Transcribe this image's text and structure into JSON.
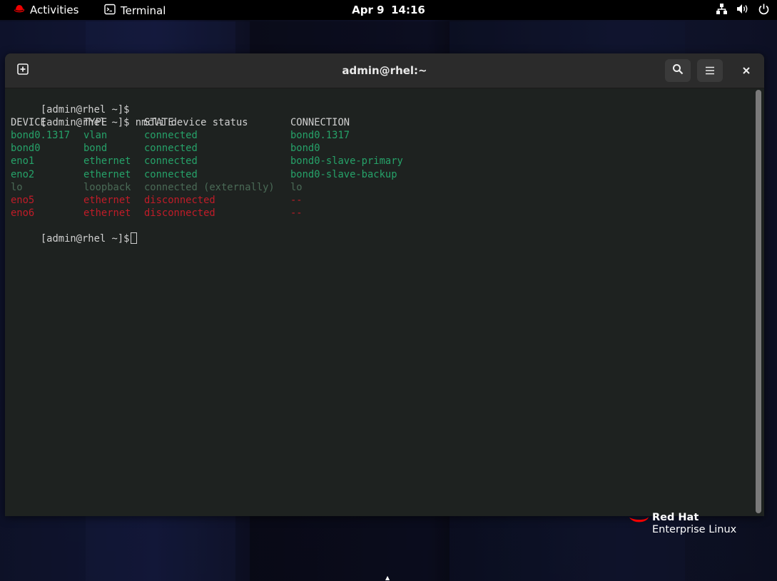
{
  "topbar": {
    "activities_label": "Activities",
    "app_label": "Terminal",
    "clock_date": "Apr 9",
    "clock_time": "14:16",
    "tray_icons": [
      "network-icon",
      "volume-icon",
      "power-icon"
    ]
  },
  "window": {
    "title": "admin@rhel:~",
    "buttons": [
      "new-tab-icon",
      "search-icon",
      "hamburger-menu-icon",
      "close-icon"
    ]
  },
  "terminal": {
    "prompt": "[admin@rhel ~]$",
    "command": "nmcli device status",
    "headers": [
      "DEVICE",
      "TYPE",
      "STATE",
      "CONNECTION"
    ],
    "rows": [
      {
        "device": "bond0.1317",
        "type": "vlan",
        "state": "connected",
        "connection": "bond0.1317",
        "status": "connected"
      },
      {
        "device": "bond0",
        "type": "bond",
        "state": "connected",
        "connection": "bond0",
        "status": "connected"
      },
      {
        "device": "eno1",
        "type": "ethernet",
        "state": "connected",
        "connection": "bond0-slave-primary",
        "status": "connected"
      },
      {
        "device": "eno2",
        "type": "ethernet",
        "state": "connected",
        "connection": "bond0-slave-backup",
        "status": "connected"
      },
      {
        "device": "lo",
        "type": "loopback",
        "state": "connected (externally)",
        "connection": "lo",
        "status": "external"
      },
      {
        "device": "eno5",
        "type": "ethernet",
        "state": "disconnected",
        "connection": "--",
        "status": "disconnected"
      },
      {
        "device": "eno6",
        "type": "ethernet",
        "state": "disconnected",
        "connection": "--",
        "status": "disconnected"
      }
    ]
  },
  "colors": {
    "connected": "#26a269",
    "external": "#4a6a56",
    "disconnected": "#c01c28"
  },
  "branding": {
    "line1": "Red Hat",
    "line2": "Enterprise Linux"
  }
}
